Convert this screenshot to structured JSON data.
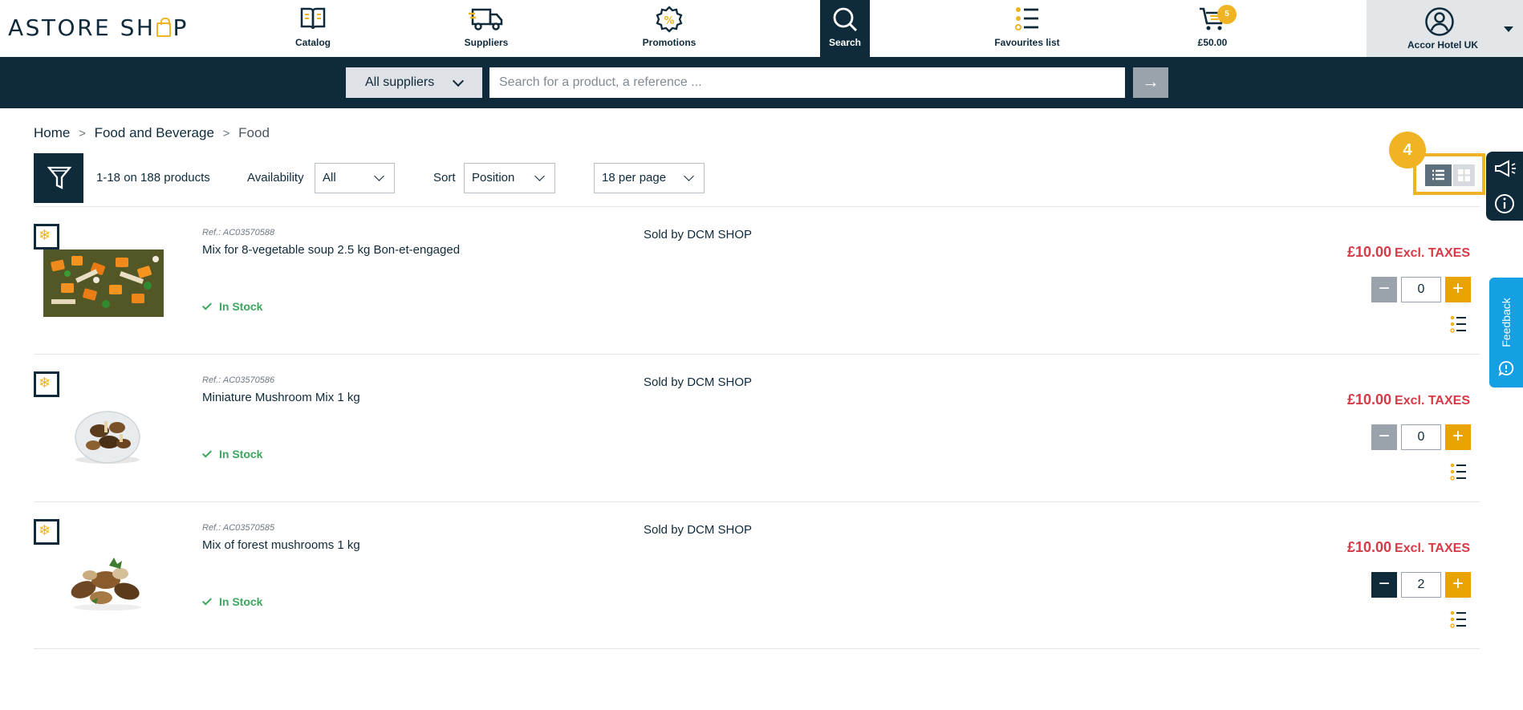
{
  "brand": {
    "logo_left": "ASTORE SH",
    "logo_right": "P"
  },
  "nav": {
    "catalog": "Catalog",
    "suppliers": "Suppliers",
    "promotions": "Promotions",
    "search": "Search",
    "favourites": "Favourites list",
    "cart_total": "£50.00",
    "cart_count": "5"
  },
  "account": {
    "name": "Accor Hotel UK"
  },
  "searchbar": {
    "supplier_filter": "All suppliers",
    "placeholder": "Search for a product, a reference ...",
    "go": "→"
  },
  "breadcrumb": {
    "home": "Home",
    "category": "Food and Beverage",
    "current": "Food",
    "separator": ">"
  },
  "toolbar": {
    "count": "1-18 on 188 products",
    "availability_label": "Availability",
    "availability_value": "All",
    "sort_label": "Sort",
    "sort_value": "Position",
    "per_page": "18 per page",
    "view_badge": "4"
  },
  "feedback": {
    "label": "Feedback"
  },
  "colors": {
    "navy": "#0e2a3b",
    "accent": "#f0b323",
    "price": "#d63a47",
    "stock": "#3da55d",
    "feedback": "#15a0e3"
  },
  "products": [
    {
      "ref": "Ref.: AC03570588",
      "name": "Mix for 8-vegetable soup 2.5 kg Bon-et-engaged",
      "stock": "In Stock",
      "seller": "Sold by DCM SHOP",
      "price": "£10.00",
      "tax": "Excl. TAXES",
      "quantity": "0"
    },
    {
      "ref": "Ref.: AC03570586",
      "name": "Miniature Mushroom Mix 1 kg",
      "stock": "In Stock",
      "seller": "Sold by DCM SHOP",
      "price": "£10.00",
      "tax": "Excl. TAXES",
      "quantity": "0"
    },
    {
      "ref": "Ref.: AC03570585",
      "name": "Mix of forest mushrooms 1 kg",
      "stock": "In Stock",
      "seller": "Sold by DCM SHOP",
      "price": "£10.00",
      "tax": "Excl. TAXES",
      "quantity": "2"
    }
  ],
  "icons": {
    "frozen": "snowflake-icon",
    "favourite": "list-icon"
  }
}
